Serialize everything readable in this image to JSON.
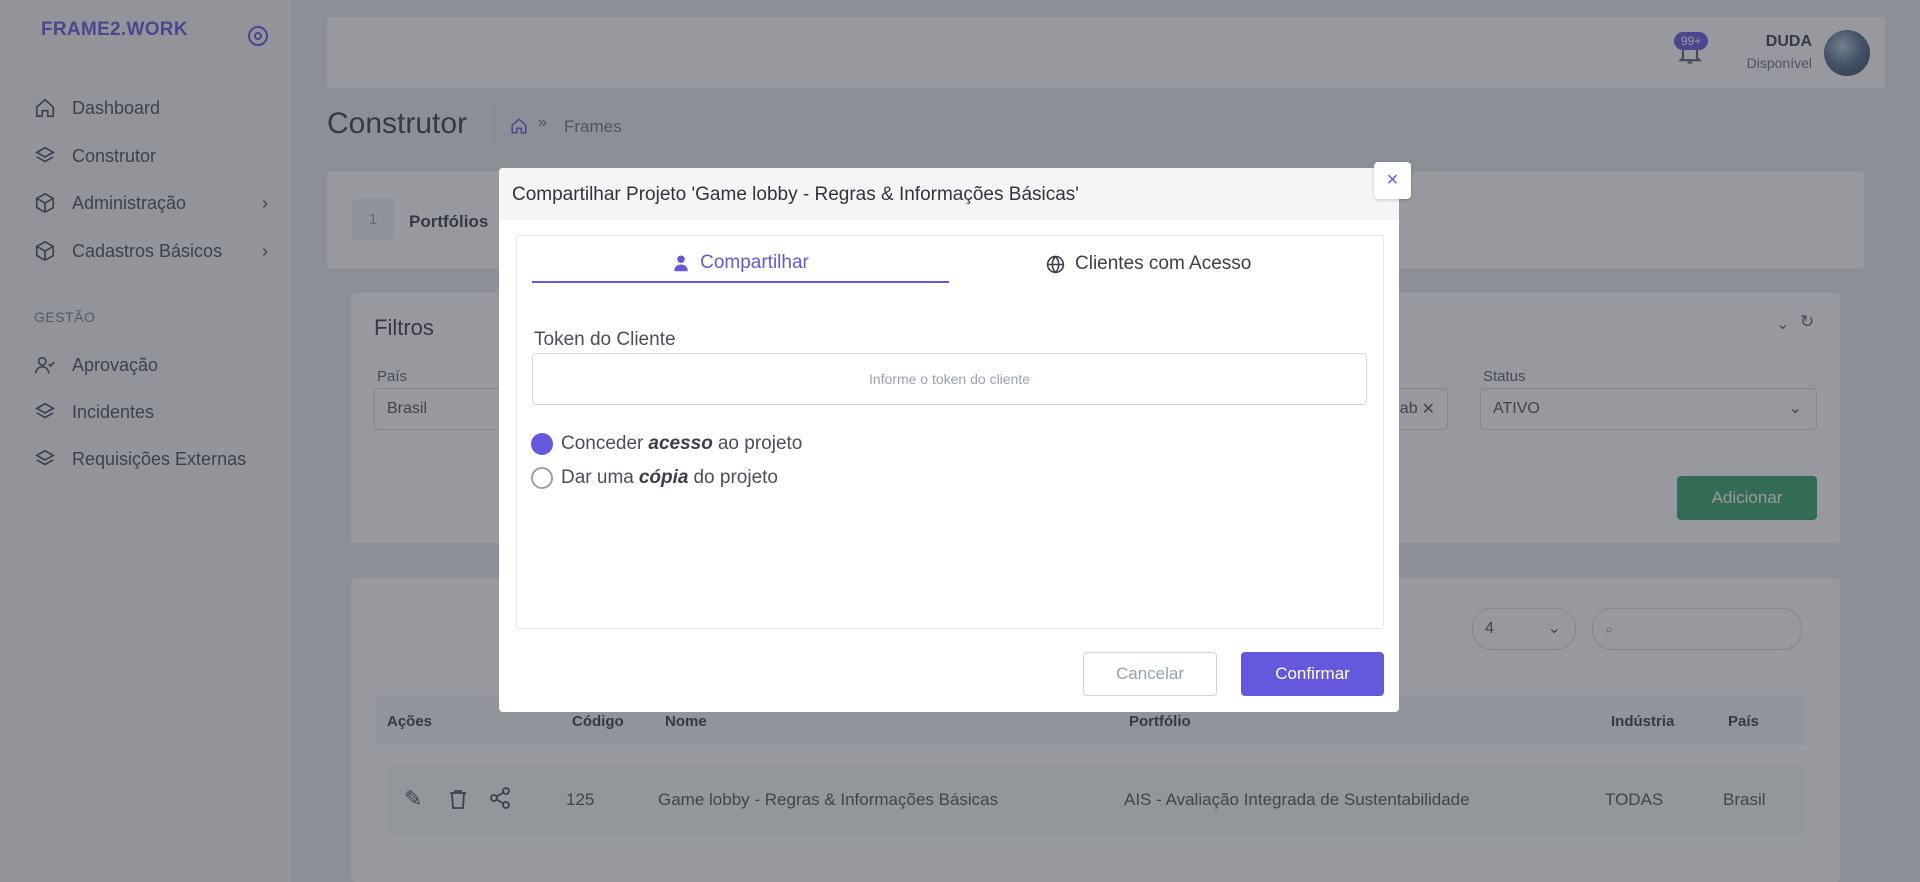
{
  "brand": "FRAME2.WORK",
  "sidebar": {
    "items": [
      {
        "label": "Dashboard",
        "icon": "home-icon"
      },
      {
        "label": "Construtor",
        "icon": "layers-icon"
      },
      {
        "label": "Administração",
        "icon": "box-icon"
      },
      {
        "label": "Cadastros Básicos",
        "icon": "box-icon"
      }
    ],
    "section_label": "GESTÃO",
    "section_items": [
      {
        "label": "Aprovação",
        "icon": "user-check-icon"
      },
      {
        "label": "Incidentes",
        "icon": "layers-icon"
      },
      {
        "label": "Requisições Externas",
        "icon": "layers-icon"
      }
    ]
  },
  "topbar": {
    "notification_count": "99+",
    "user_name": "DUDA",
    "user_status": "Disponível"
  },
  "page": {
    "title": "Construtor",
    "breadcrumb": "Frames",
    "step_number": "1",
    "step_label": "Portfólios",
    "filters_title": "Filtros",
    "filters": {
      "pais_label": "País",
      "pais_value": "Brasil",
      "status_label": "Status",
      "status_value": "ATIVO",
      "tag_fragment": "ab"
    },
    "add_button": "Adicionar",
    "page_size": "4",
    "table": {
      "headers": [
        "Ações",
        "Código",
        "Nome",
        "Portfólio",
        "Indústria",
        "País"
      ],
      "rows": [
        {
          "codigo": "125",
          "nome": "Game lobby - Regras & Informações Básicas",
          "portfolio": "AIS - Avaliação Integrada de Sustentabilidade",
          "industria": "TODAS",
          "pais": "Brasil"
        }
      ]
    }
  },
  "modal": {
    "title": "Compartilhar Projeto 'Game lobby - Regras & Informações Básicas'",
    "close": "×",
    "tabs": [
      {
        "label": "Compartilhar",
        "icon": "user-icon"
      },
      {
        "label": "Clientes com Acesso",
        "icon": "globe-icon"
      }
    ],
    "token_label": "Token do Cliente",
    "token_placeholder": "Informe o token do cliente",
    "option_access": {
      "pre": "Conceder",
      "em": "acesso",
      "post": "ao projeto"
    },
    "option_copy": {
      "pre": "Dar uma",
      "em": "cópia",
      "post": "do projeto"
    },
    "cancel": "Cancelar",
    "confirm": "Confirmar"
  },
  "colors": {
    "accent": "#6658dd",
    "success": "#36a56a"
  }
}
